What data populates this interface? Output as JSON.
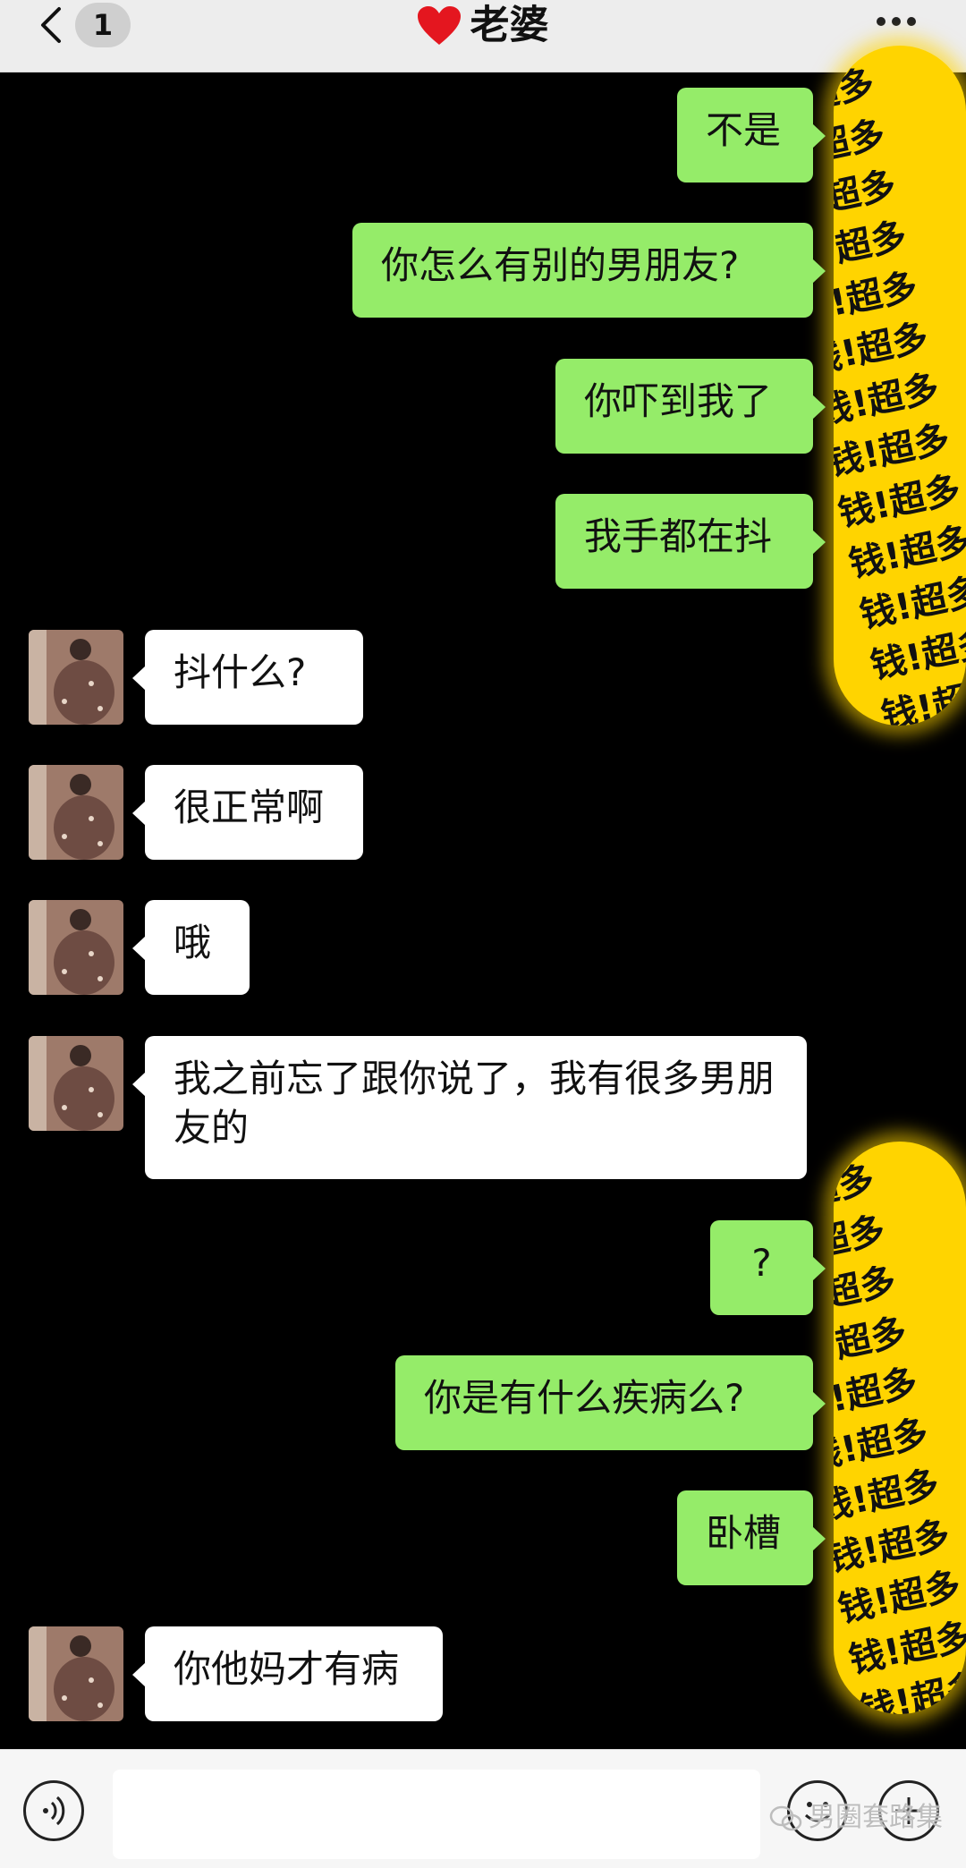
{
  "header": {
    "back_badge": "1",
    "title": "老婆"
  },
  "messages": [
    {
      "side": "out",
      "text": "不是"
    },
    {
      "side": "out",
      "text": "你怎么有别的男朋友?"
    },
    {
      "side": "out",
      "text": "你吓到我了"
    },
    {
      "side": "out",
      "text": "我手都在抖"
    },
    {
      "side": "in",
      "text": "抖什么?"
    },
    {
      "side": "in",
      "text": "很正常啊"
    },
    {
      "side": "in",
      "text": "哦"
    },
    {
      "side": "in",
      "text": "我之前忘了跟你说了，我有很多男朋友的"
    },
    {
      "side": "out",
      "text": "?"
    },
    {
      "side": "out",
      "text": "你是有什么疾病么?"
    },
    {
      "side": "out",
      "text": "卧槽"
    },
    {
      "side": "in",
      "text": "你他妈才有病"
    }
  ],
  "censor": {
    "text": "钱!超多钱!超多钱!超多钱!超多钱!超多钱!超多钱!超多钱!超多钱!超多钱!超多钱!超多钱!超多钱!超多钱!超多钱!超多",
    "color": "#ffd400"
  },
  "watermark": {
    "text": "男圈套路集"
  },
  "colors": {
    "outgoing_bubble": "#95ec69",
    "incoming_bubble": "#ffffff",
    "chat_background": "#000000"
  }
}
